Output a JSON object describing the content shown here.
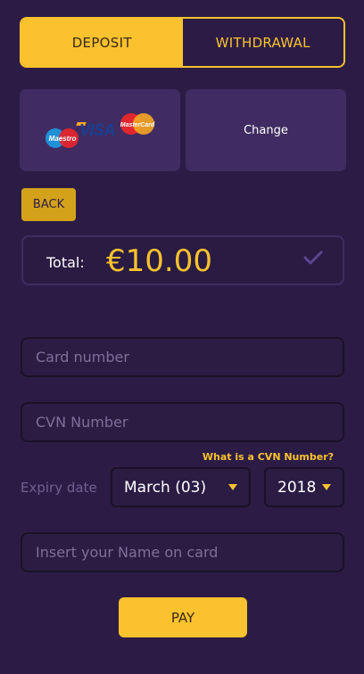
{
  "tabs": [
    {
      "label": "DEPOSIT",
      "active": true
    },
    {
      "label": "WITHDRAWAL",
      "active": false
    }
  ],
  "payment_method": {
    "logos": [
      "maestro-logo",
      "visa-logo",
      "mastercard-logo"
    ],
    "change_label": "Change"
  },
  "back_label": "BACK",
  "total": {
    "label": "Total:",
    "amount": "€10.00"
  },
  "form": {
    "card_number_placeholder": "Card number",
    "cvn_placeholder": "CVN Number",
    "cvn_help": "What is a CVN Number?",
    "expiry_label": "Expiry date",
    "expiry_month": "March (03)",
    "expiry_year": "2018",
    "name_placeholder": "Insert your Name on card"
  },
  "pay_label": "PAY",
  "colors": {
    "background": "#2c1c45",
    "accent": "#f9c22e",
    "card": "#402c62"
  }
}
